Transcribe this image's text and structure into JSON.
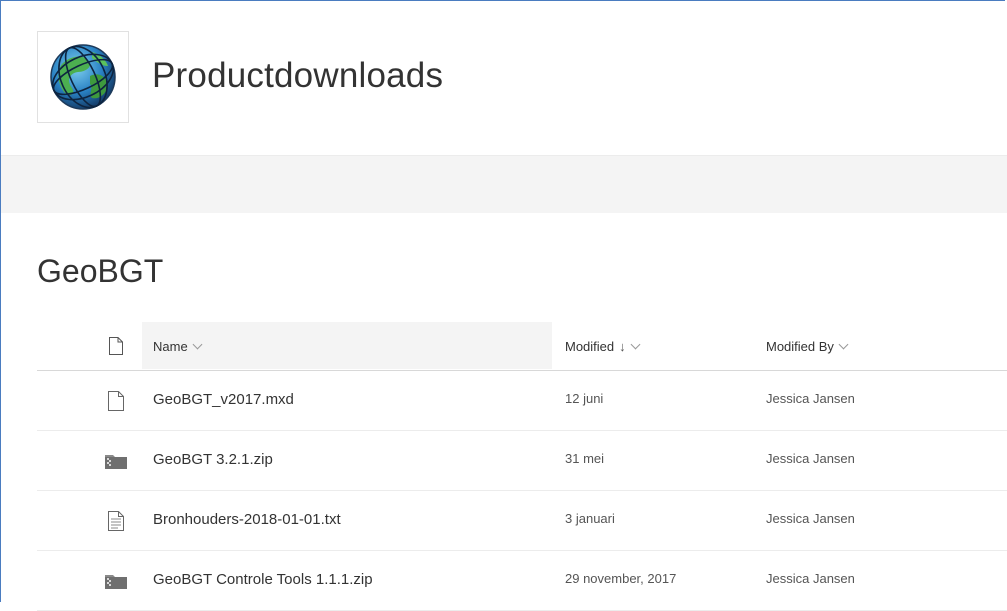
{
  "site": {
    "title": "Productdownloads",
    "logo_icon": "globe-icon"
  },
  "library": {
    "title": "GeoBGT"
  },
  "columns": {
    "type_icon": "file-type-header-icon",
    "name": "Name",
    "modified": "Modified",
    "modified_sort": "↓",
    "modified_by": "Modified By"
  },
  "files": [
    {
      "icon": "generic-file-icon",
      "name": "GeoBGT_v2017.mxd",
      "modified": "12 juni",
      "modified_by": "Jessica Jansen"
    },
    {
      "icon": "zip-file-icon",
      "name": "GeoBGT 3.2.1.zip",
      "modified": "31 mei",
      "modified_by": "Jessica Jansen"
    },
    {
      "icon": "text-file-icon",
      "name": "Bronhouders-2018-01-01.txt",
      "modified": "3 januari",
      "modified_by": "Jessica Jansen"
    },
    {
      "icon": "zip-file-icon",
      "name": "GeoBGT Controle Tools 1.1.1.zip",
      "modified": "29 november, 2017",
      "modified_by": "Jessica Jansen"
    }
  ],
  "colors": {
    "frame_border": "#4a7cc0",
    "command_bar": "#f4f4f4"
  }
}
